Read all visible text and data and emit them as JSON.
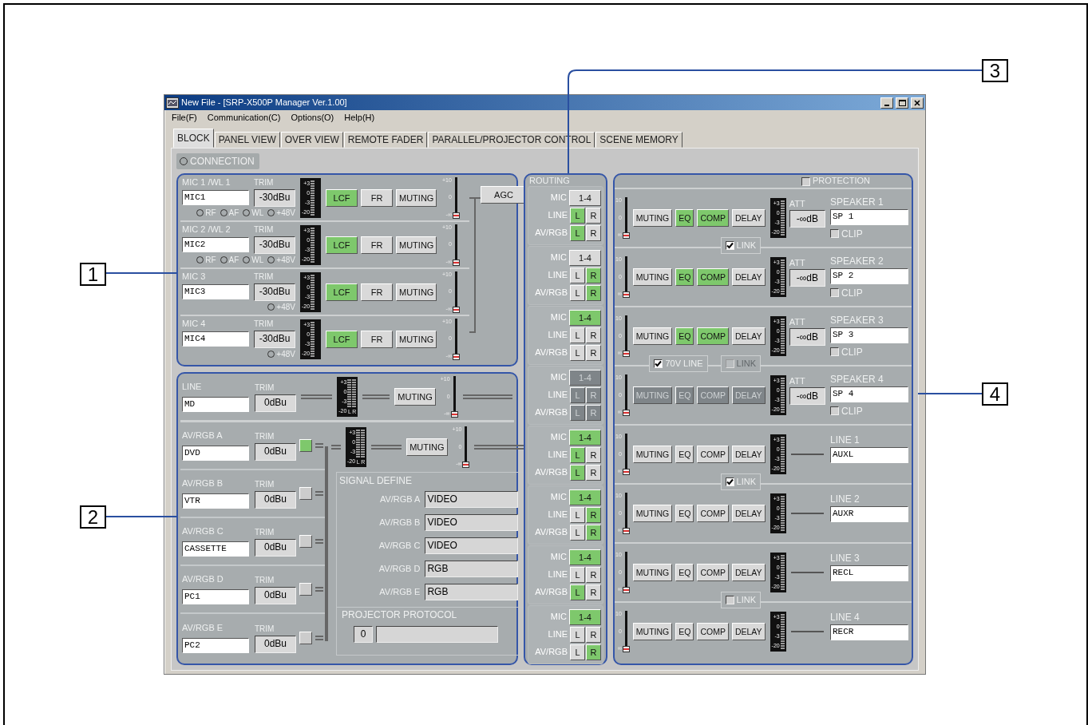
{
  "window": {
    "title": "New File - [SRP-X500P Manager Ver.1.00]"
  },
  "menu": [
    "File(F)",
    "Communication(C)",
    "Options(O)",
    "Help(H)"
  ],
  "tabs": [
    {
      "label": "BLOCK",
      "selected": true
    },
    {
      "label": "PANEL VIEW",
      "selected": false
    },
    {
      "label": "OVER VIEW",
      "selected": false
    },
    {
      "label": "REMOTE FADER",
      "selected": false
    },
    {
      "label": "PARALLEL/PROJECTOR CONTROL",
      "selected": false
    },
    {
      "label": "SCENE MEMORY",
      "selected": false
    }
  ],
  "connection": {
    "label": "CONNECTION",
    "on": false
  },
  "mic_channels": [
    {
      "name": "MIC 1 /WL 1",
      "trim_label": "TRIM",
      "value": "MIC1",
      "trim": "-30dBu",
      "indicators": [
        {
          "label": "RF",
          "on": false
        },
        {
          "label": "AF",
          "on": false
        },
        {
          "label": "WL",
          "on": false
        },
        {
          "label": "+48V",
          "on": false
        }
      ],
      "buttons": [
        {
          "label": "LCF",
          "on": true
        },
        {
          "label": "FR",
          "on": false
        },
        {
          "label": "MUTING",
          "on": false
        }
      ],
      "meter": {
        "scale": [
          "+3",
          "0",
          "-3",
          "-20"
        ]
      },
      "fader": {
        "scale": [
          "+10",
          "0",
          "-∞"
        ],
        "level": 0
      }
    },
    {
      "name": "MIC 2 /WL 2",
      "trim_label": "TRIM",
      "value": "MIC2",
      "trim": "-30dBu",
      "indicators": [
        {
          "label": "RF",
          "on": false
        },
        {
          "label": "AF",
          "on": false
        },
        {
          "label": "WL",
          "on": false
        },
        {
          "label": "+48V",
          "on": false
        }
      ],
      "buttons": [
        {
          "label": "LCF",
          "on": true
        },
        {
          "label": "FR",
          "on": false
        },
        {
          "label": "MUTING",
          "on": false
        }
      ],
      "meter": {
        "scale": [
          "+3",
          "0",
          "-3",
          "-20"
        ]
      },
      "fader": {
        "scale": [
          "+10",
          "0",
          "-∞"
        ],
        "level": 0
      }
    },
    {
      "name": "MIC 3",
      "trim_label": "TRIM",
      "value": "MIC3",
      "trim": "-30dBu",
      "indicators": [
        {
          "label": "+48V",
          "on": false
        }
      ],
      "buttons": [
        {
          "label": "LCF",
          "on": true
        },
        {
          "label": "FR",
          "on": false
        },
        {
          "label": "MUTING",
          "on": false
        }
      ],
      "meter": {
        "scale": [
          "+3",
          "0",
          "-3",
          "-20"
        ]
      },
      "fader": {
        "scale": [
          "+10",
          "0",
          "-∞"
        ],
        "level": 0
      }
    },
    {
      "name": "MIC 4",
      "trim_label": "TRIM",
      "value": "MIC4",
      "trim": "-30dBu",
      "indicators": [
        {
          "label": "+48V",
          "on": false
        }
      ],
      "buttons": [
        {
          "label": "LCF",
          "on": true
        },
        {
          "label": "FR",
          "on": false
        },
        {
          "label": "MUTING",
          "on": false
        }
      ],
      "meter": {
        "scale": [
          "+3",
          "0",
          "-3",
          "-20"
        ]
      },
      "fader": {
        "scale": [
          "+10",
          "0",
          "-∞"
        ],
        "level": 0
      }
    }
  ],
  "agc": {
    "label": "AGC",
    "on": false
  },
  "line_input": {
    "name": "LINE",
    "trim_label": "TRIM",
    "value": "MD",
    "trim": "0dBu",
    "meter": {
      "scale": [
        "+3",
        "0",
        "-3",
        "-20"
      ],
      "channels": [
        "L",
        "R"
      ]
    },
    "muting": {
      "label": "MUTING",
      "on": false
    },
    "fader": {
      "scale": [
        "+10",
        "0",
        "-∞"
      ],
      "level": 0
    }
  },
  "av_rgb": {
    "inputs": [
      {
        "name": "AV/RGB A",
        "trim_label": "TRIM",
        "value": "DVD",
        "trim": "0dBu",
        "selected": true
      },
      {
        "name": "AV/RGB B",
        "trim_label": "TRIM",
        "value": "VTR",
        "trim": "0dBu",
        "selected": false
      },
      {
        "name": "AV/RGB C",
        "trim_label": "TRIM",
        "value": "CASSETTE",
        "trim": "0dBu",
        "selected": false
      },
      {
        "name": "AV/RGB D",
        "trim_label": "TRIM",
        "value": "PC1",
        "trim": "0dBu",
        "selected": false
      },
      {
        "name": "AV/RGB E",
        "trim_label": "TRIM",
        "value": "PC2",
        "trim": "0dBu",
        "selected": false
      }
    ],
    "meter": {
      "scale": [
        "+3",
        "0",
        "-3",
        "-20"
      ],
      "channels": [
        "L",
        "R"
      ]
    },
    "muting": {
      "label": "MUTING",
      "on": false
    },
    "fader": {
      "scale": [
        "+10",
        "0",
        "-∞"
      ],
      "level": 0
    }
  },
  "signal_define": {
    "title": "SIGNAL DEFINE",
    "rows": [
      {
        "label": "AV/RGB A",
        "value": "VIDEO"
      },
      {
        "label": "AV/RGB B",
        "value": "VIDEO"
      },
      {
        "label": "AV/RGB C",
        "value": "VIDEO"
      },
      {
        "label": "AV/RGB D",
        "value": "RGB"
      },
      {
        "label": "AV/RGB E",
        "value": "RGB"
      }
    ]
  },
  "projector_protocol": {
    "title": "PROJECTOR PROTOCOL",
    "number": "0"
  },
  "routing": {
    "title": "ROUTING",
    "groups": [
      {
        "disabled": false,
        "rows": [
          {
            "label": "MIC",
            "buttons": [
              {
                "label": "1-4",
                "on": false
              }
            ]
          },
          {
            "label": "LINE",
            "buttons": [
              {
                "label": "L",
                "on": true
              },
              {
                "label": "R",
                "on": false
              }
            ]
          },
          {
            "label": "AV/RGB",
            "buttons": [
              {
                "label": "L",
                "on": true
              },
              {
                "label": "R",
                "on": false
              }
            ]
          }
        ]
      },
      {
        "disabled": false,
        "rows": [
          {
            "label": "MIC",
            "buttons": [
              {
                "label": "1-4",
                "on": false
              }
            ]
          },
          {
            "label": "LINE",
            "buttons": [
              {
                "label": "L",
                "on": false
              },
              {
                "label": "R",
                "on": true
              }
            ]
          },
          {
            "label": "AV/RGB",
            "buttons": [
              {
                "label": "L",
                "on": false
              },
              {
                "label": "R",
                "on": true
              }
            ]
          }
        ]
      },
      {
        "disabled": false,
        "rows": [
          {
            "label": "MIC",
            "buttons": [
              {
                "label": "1-4",
                "on": true
              }
            ]
          },
          {
            "label": "LINE",
            "buttons": [
              {
                "label": "L",
                "on": false
              },
              {
                "label": "R",
                "on": false
              }
            ]
          },
          {
            "label": "AV/RGB",
            "buttons": [
              {
                "label": "L",
                "on": false
              },
              {
                "label": "R",
                "on": false
              }
            ]
          }
        ]
      },
      {
        "disabled": true,
        "rows": [
          {
            "label": "MIC",
            "buttons": [
              {
                "label": "1-4",
                "on": false
              }
            ]
          },
          {
            "label": "LINE",
            "buttons": [
              {
                "label": "L",
                "on": false
              },
              {
                "label": "R",
                "on": false
              }
            ]
          },
          {
            "label": "AV/RGB",
            "buttons": [
              {
                "label": "L",
                "on": false
              },
              {
                "label": "R",
                "on": false
              }
            ]
          }
        ]
      },
      {
        "disabled": false,
        "rows": [
          {
            "label": "MIC",
            "buttons": [
              {
                "label": "1-4",
                "on": true
              }
            ]
          },
          {
            "label": "LINE",
            "buttons": [
              {
                "label": "L",
                "on": true
              },
              {
                "label": "R",
                "on": false
              }
            ]
          },
          {
            "label": "AV/RGB",
            "buttons": [
              {
                "label": "L",
                "on": true
              },
              {
                "label": "R",
                "on": false
              }
            ]
          }
        ]
      },
      {
        "disabled": false,
        "rows": [
          {
            "label": "MIC",
            "buttons": [
              {
                "label": "1-4",
                "on": true
              }
            ]
          },
          {
            "label": "LINE",
            "buttons": [
              {
                "label": "L",
                "on": false
              },
              {
                "label": "R",
                "on": true
              }
            ]
          },
          {
            "label": "AV/RGB",
            "buttons": [
              {
                "label": "L",
                "on": false
              },
              {
                "label": "R",
                "on": true
              }
            ]
          }
        ]
      },
      {
        "disabled": false,
        "rows": [
          {
            "label": "MIC",
            "buttons": [
              {
                "label": "1-4",
                "on": true
              }
            ]
          },
          {
            "label": "LINE",
            "buttons": [
              {
                "label": "L",
                "on": false
              },
              {
                "label": "R",
                "on": false
              }
            ]
          },
          {
            "label": "AV/RGB",
            "buttons": [
              {
                "label": "L",
                "on": true
              },
              {
                "label": "R",
                "on": false
              }
            ]
          }
        ]
      },
      {
        "disabled": false,
        "rows": [
          {
            "label": "MIC",
            "buttons": [
              {
                "label": "1-4",
                "on": true
              }
            ]
          },
          {
            "label": "LINE",
            "buttons": [
              {
                "label": "L",
                "on": false
              },
              {
                "label": "R",
                "on": false
              }
            ]
          },
          {
            "label": "AV/RGB",
            "buttons": [
              {
                "label": "L",
                "on": false
              },
              {
                "label": "R",
                "on": true
              }
            ]
          }
        ]
      }
    ]
  },
  "protection": {
    "label": "PROTECTION",
    "checked": false
  },
  "outputs": [
    {
      "kind": "speaker",
      "title": "SPEAKER 1",
      "disabled": false,
      "fader": {
        "scale": [
          "10",
          "0",
          "∞"
        ],
        "level": 0
      },
      "buttons": [
        {
          "label": "MUTING",
          "on": false
        },
        {
          "label": "EQ",
          "on": true
        },
        {
          "label": "COMP",
          "on": true
        },
        {
          "label": "DELAY",
          "on": false
        }
      ],
      "meter": {
        "scale": [
          "+3",
          "0",
          "-3",
          "-20"
        ]
      },
      "att_label": "ATT",
      "att": "-∞dB",
      "value": "SP 1",
      "clip": {
        "label": "CLIP",
        "checked": false
      },
      "links": [
        {
          "label": "LINK",
          "checked": true,
          "disabled": false
        }
      ]
    },
    {
      "kind": "speaker",
      "title": "SPEAKER 2",
      "disabled": false,
      "fader": {
        "scale": [
          "10",
          "0",
          "∞"
        ],
        "level": 0
      },
      "buttons": [
        {
          "label": "MUTING",
          "on": false
        },
        {
          "label": "EQ",
          "on": true
        },
        {
          "label": "COMP",
          "on": true
        },
        {
          "label": "DELAY",
          "on": false
        }
      ],
      "meter": {
        "scale": [
          "+3",
          "0",
          "-3",
          "-20"
        ]
      },
      "att_label": "ATT",
      "att": "-∞dB",
      "value": "SP 2",
      "clip": {
        "label": "CLIP",
        "checked": false
      }
    },
    {
      "kind": "speaker",
      "title": "SPEAKER 3",
      "disabled": false,
      "fader": {
        "scale": [
          "10",
          "0",
          "∞"
        ],
        "level": 0
      },
      "buttons": [
        {
          "label": "MUTING",
          "on": false
        },
        {
          "label": "EQ",
          "on": true
        },
        {
          "label": "COMP",
          "on": true
        },
        {
          "label": "DELAY",
          "on": false
        }
      ],
      "meter": {
        "scale": [
          "+3",
          "0",
          "-3",
          "-20"
        ]
      },
      "att_label": "ATT",
      "att": "-∞dB",
      "value": "SP 3",
      "clip": {
        "label": "CLIP",
        "checked": false
      },
      "links": [
        {
          "label": "70V LINE",
          "checked": true,
          "disabled": false
        },
        {
          "label": "LINK",
          "checked": false,
          "disabled": true
        }
      ]
    },
    {
      "kind": "speaker",
      "title": "SPEAKER 4",
      "disabled": true,
      "fader": {
        "scale": [
          "10",
          "0",
          "∞"
        ],
        "level": 0
      },
      "buttons": [
        {
          "label": "MUTING",
          "on": false
        },
        {
          "label": "EQ",
          "on": false
        },
        {
          "label": "COMP",
          "on": false
        },
        {
          "label": "DELAY",
          "on": false
        }
      ],
      "meter": {
        "scale": [
          "+3",
          "0",
          "-3",
          "-20"
        ]
      },
      "att_label": "ATT",
      "att": "-∞dB",
      "value": "SP 4",
      "clip": {
        "label": "CLIP",
        "checked": false
      }
    },
    {
      "kind": "line",
      "title": "LINE 1",
      "disabled": false,
      "fader": {
        "scale": [
          "10",
          "0",
          "∞"
        ],
        "level": 0
      },
      "buttons": [
        {
          "label": "MUTING",
          "on": false
        },
        {
          "label": "EQ",
          "on": false
        },
        {
          "label": "COMP",
          "on": false
        },
        {
          "label": "DELAY",
          "on": false
        }
      ],
      "meter": {
        "scale": [
          "+3",
          "0",
          "-3",
          "-20"
        ]
      },
      "value": "AUXL",
      "links": [
        {
          "label": "LINK",
          "checked": true,
          "disabled": false
        }
      ]
    },
    {
      "kind": "line",
      "title": "LINE 2",
      "disabled": false,
      "fader": {
        "scale": [
          "10",
          "0",
          "∞"
        ],
        "level": 0
      },
      "buttons": [
        {
          "label": "MUTING",
          "on": false
        },
        {
          "label": "EQ",
          "on": false
        },
        {
          "label": "COMP",
          "on": false
        },
        {
          "label": "DELAY",
          "on": false
        }
      ],
      "meter": {
        "scale": [
          "+3",
          "0",
          "-3",
          "-20"
        ]
      },
      "value": "AUXR"
    },
    {
      "kind": "line",
      "title": "LINE 3",
      "disabled": false,
      "fader": {
        "scale": [
          "10",
          "0",
          "∞"
        ],
        "level": 0
      },
      "buttons": [
        {
          "label": "MUTING",
          "on": false
        },
        {
          "label": "EQ",
          "on": false
        },
        {
          "label": "COMP",
          "on": false
        },
        {
          "label": "DELAY",
          "on": false
        }
      ],
      "meter": {
        "scale": [
          "+3",
          "0",
          "-3",
          "-20"
        ]
      },
      "value": "RECL",
      "links": [
        {
          "label": "LINK",
          "checked": false,
          "disabled": false
        }
      ]
    },
    {
      "kind": "line",
      "title": "LINE 4",
      "disabled": false,
      "fader": {
        "scale": [
          "10",
          "0",
          "∞"
        ],
        "level": 0
      },
      "buttons": [
        {
          "label": "MUTING",
          "on": false
        },
        {
          "label": "EQ",
          "on": false
        },
        {
          "label": "COMP",
          "on": false
        },
        {
          "label": "DELAY",
          "on": false
        }
      ],
      "meter": {
        "scale": [
          "+3",
          "0",
          "-3",
          "-20"
        ]
      },
      "value": "RECR"
    }
  ],
  "callouts": [
    "1",
    "2",
    "3",
    "4"
  ]
}
